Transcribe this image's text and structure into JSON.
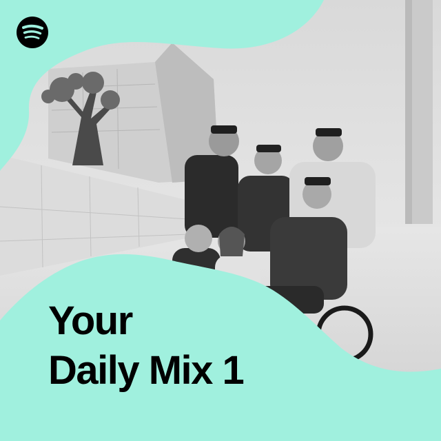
{
  "cover": {
    "title_line1": "Your",
    "title_line2": "Daily Mix 1",
    "logo_icon": "spotify-logo-icon",
    "photo_desc_icon": "band-photo-image"
  },
  "colors": {
    "accent": "#a0f0de",
    "title_text": "#000000",
    "logo": "#000000",
    "photo_tint": "#6f6f6f"
  }
}
